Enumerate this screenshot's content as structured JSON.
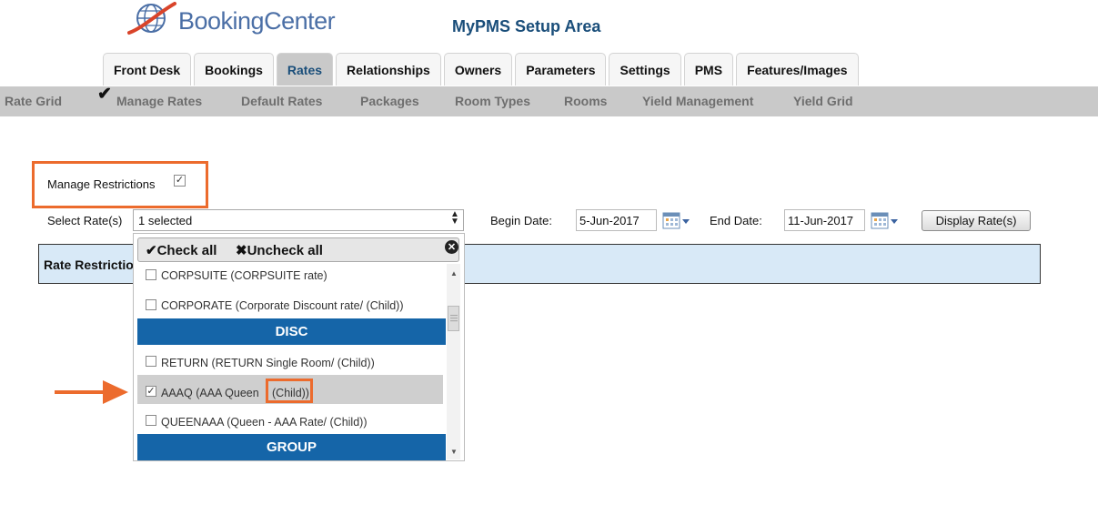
{
  "header": {
    "logo_text": "BookingCenter",
    "setup_title": "MyPMS Setup Area"
  },
  "tabs": [
    {
      "label": "Front Desk",
      "active": false
    },
    {
      "label": "Bookings",
      "active": false
    },
    {
      "label": "Rates",
      "active": true
    },
    {
      "label": "Relationships",
      "active": false
    },
    {
      "label": "Owners",
      "active": false
    },
    {
      "label": "Parameters",
      "active": false
    },
    {
      "label": "Settings",
      "active": false
    },
    {
      "label": "PMS",
      "active": false
    },
    {
      "label": "Features/Images",
      "active": false
    }
  ],
  "subnav": [
    {
      "label": "Rate Grid"
    },
    {
      "label": "Manage Rates",
      "checked": true
    },
    {
      "label": "Default Rates"
    },
    {
      "label": "Packages"
    },
    {
      "label": "Room Types"
    },
    {
      "label": "Rooms"
    },
    {
      "label": "Yield Management"
    },
    {
      "label": "Yield Grid"
    }
  ],
  "manage_restrictions": {
    "label": "Manage Restrictions",
    "checked": true
  },
  "filters": {
    "select_rates_label": "Select Rate(s)",
    "select_rates_value": "1 selected",
    "begin_label": "Begin Date:",
    "begin_value": "5-Jun-2017",
    "end_label": "End Date:",
    "end_value": "11-Jun-2017",
    "display_button": "Display Rate(s)"
  },
  "rate_restrictions_label": "Rate Restrictio",
  "dropdown": {
    "check_all": "Check all",
    "uncheck_all": "Uncheck all",
    "options": [
      {
        "label": "CORPSUITE (CORPSUITE rate)",
        "checked": false
      },
      {
        "label": "CORPORATE (Corporate Discount rate/ (Child))",
        "checked": false
      },
      {
        "label": "RETURN (RETURN Single Room/ (Child))",
        "checked": false
      },
      {
        "label": "AAAQ (AAA Queen",
        "label_suffix": "(Child))",
        "checked": true
      },
      {
        "label": "QUEENAAA (Queen - AAA Rate/ (Child))",
        "checked": false
      }
    ],
    "groups": [
      "DISC",
      "GROUP"
    ]
  },
  "colors": {
    "accent_orange": "#ec6b2d",
    "group_header_blue": "#1565a8",
    "title_blue": "#1a4e7a",
    "subnav_gray": "#c9c9c9",
    "restrictions_bar": "#d8e9f7"
  },
  "icons": {
    "logo": "globe-swoosh-icon",
    "checkmark": "checkmark-icon",
    "calendar": "calendar-icon",
    "close": "close-circle-icon",
    "uncheck": "x-icon",
    "arrow": "right-arrow-icon"
  }
}
